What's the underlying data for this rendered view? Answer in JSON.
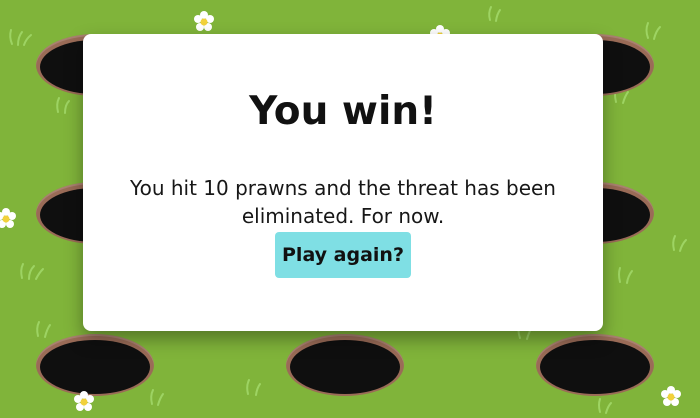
{
  "game": {
    "background_color": "#80b43a",
    "hole_rim_color": "#9a6b57",
    "hole_inner_color": "#0f0f0f"
  },
  "win_dialog": {
    "title": "You win!",
    "message": "You hit 10 prawns and the threat has been eliminated. For now.",
    "button_label": "Play again?",
    "button_color": "#7fdfe4"
  }
}
